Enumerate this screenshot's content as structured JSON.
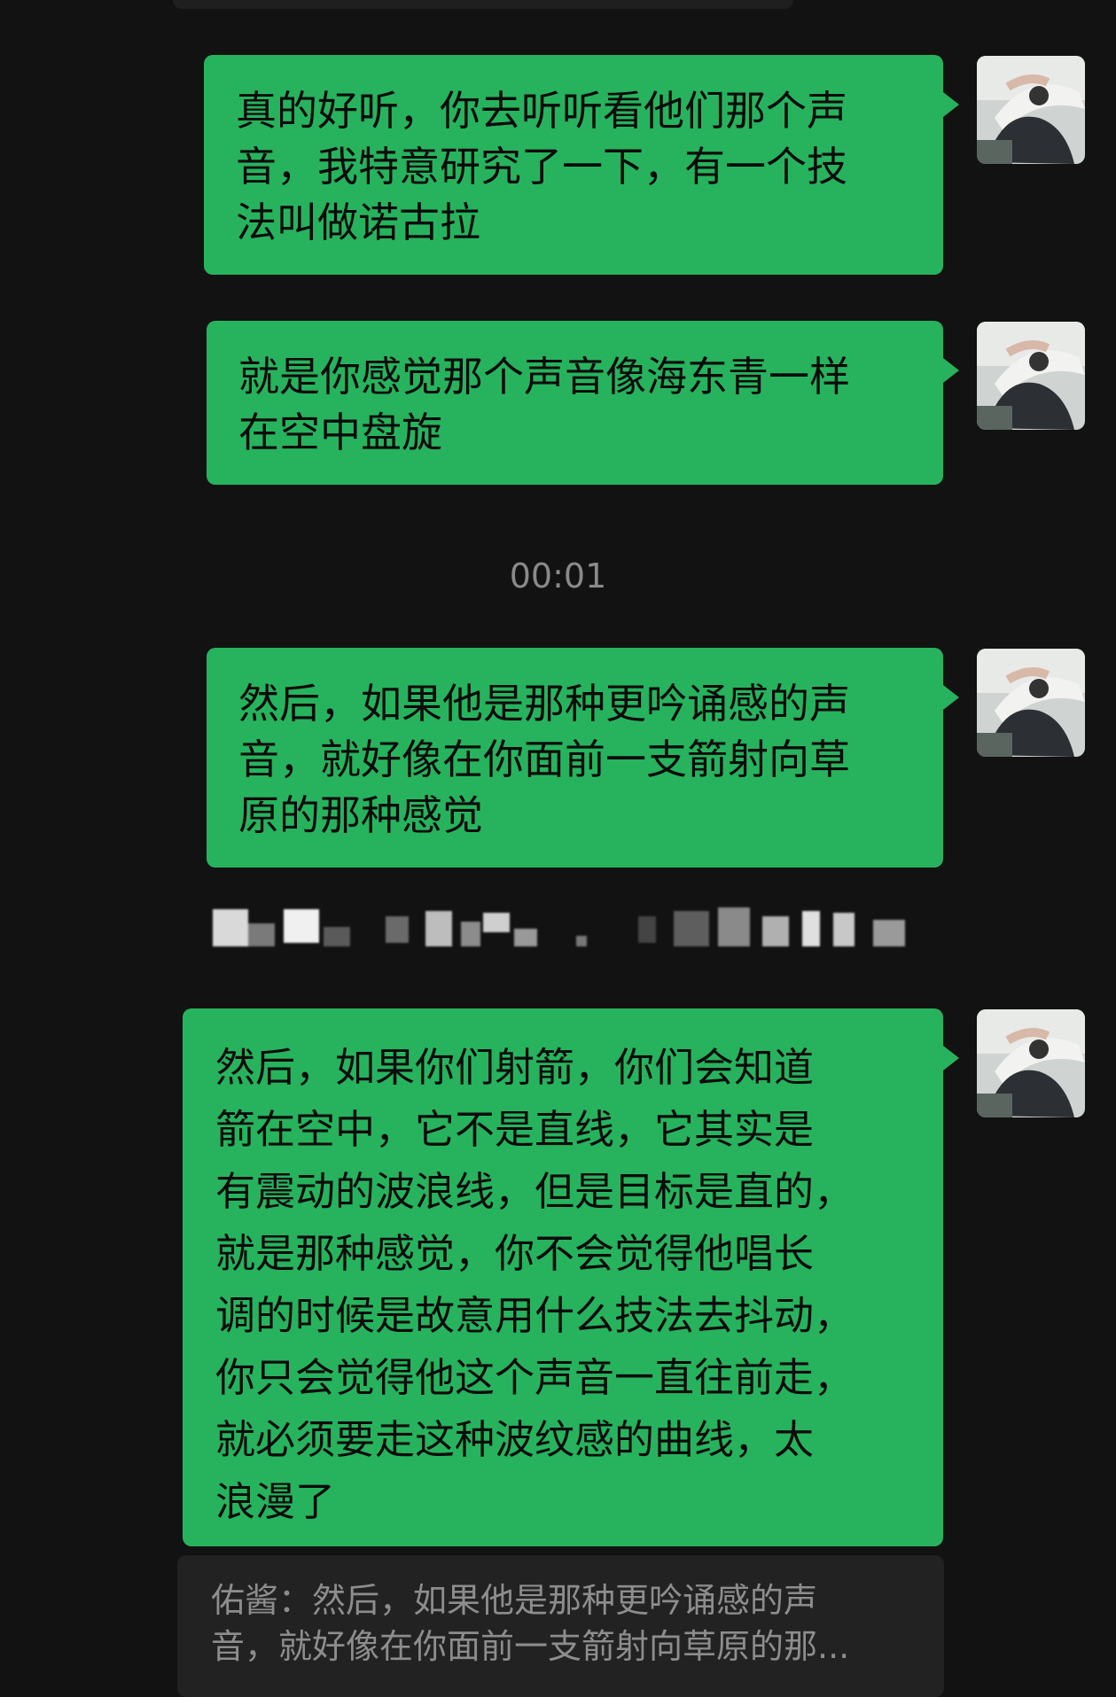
{
  "colors": {
    "background": "#121212",
    "bubble": "#27b35d",
    "timestamp": "#8a8a8a",
    "quote_background": "#222222",
    "quote_text": "#8d8d8d"
  },
  "messages": [
    {
      "sender": "self",
      "lines": [
        "真的好听，你去听听看他们那个声",
        "音，我特意研究了一下，有一个技",
        "法叫做诺古拉"
      ]
    },
    {
      "sender": "self",
      "lines": [
        "就是你感觉那个声音像海东青一样",
        "在空中盘旋"
      ]
    },
    {
      "sender": "self",
      "lines": [
        "然后，如果他是那种更吟诵感的声",
        "音，就好像在你面前一支箭射向草",
        "原的那种感觉"
      ]
    },
    {
      "sender": "self",
      "lines": [
        "然后，如果你们射箭，你们会知道",
        "箭在空中，它不是直线，它其实是",
        "有震动的波浪线，但是目标是直的，",
        "就是那种感觉，你不会觉得他唱长",
        "调的时候是故意用什么技法去抖动，",
        "你只会觉得他这个声音一直往前走，",
        "就必须要走这种波纹感的曲线，太",
        "浪漫了"
      ]
    }
  ],
  "timestamp": "00:01",
  "quote": {
    "lines": [
      "佑酱：然后，如果他是那种更吟诵感的声",
      "音，就好像在你面前一支箭射向草原的那..."
    ]
  },
  "avatar": {
    "icon": "user-avatar-photo"
  },
  "redacted": {
    "icon": "pixelated-system-notice"
  }
}
